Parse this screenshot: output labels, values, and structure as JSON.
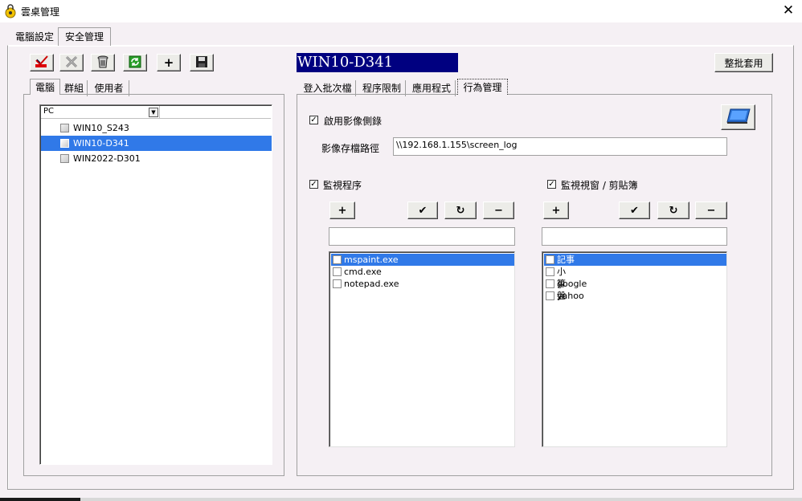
{
  "window": {
    "title": "雲桌管理",
    "close_glyph": "✕",
    "app_icon": "lock-person-icon"
  },
  "top_tabs": [
    {
      "label": "電腦設定",
      "active": false
    },
    {
      "label": "安全管理",
      "active": true
    }
  ],
  "toolbar": [
    {
      "name": "check-icon"
    },
    {
      "name": "cross-icon"
    },
    {
      "name": "trash-icon"
    },
    {
      "name": "refresh-icon"
    },
    {
      "name": "add-icon",
      "glyph": "+"
    },
    {
      "name": "save-icon"
    }
  ],
  "host": {
    "title": "WIN10-D341",
    "batch_apply_label": "整批套用"
  },
  "left_tabs": [
    {
      "label": "電腦",
      "active": true
    },
    {
      "label": "群組",
      "active": false
    },
    {
      "label": "使用者",
      "active": false
    }
  ],
  "tree": {
    "column_header": "PC",
    "dropdown_glyph": "▼",
    "items": [
      {
        "label": "WIN10_S243",
        "selected": false
      },
      {
        "label": "WIN10-D341",
        "selected": true
      },
      {
        "label": "WIN2022-D301",
        "selected": false
      }
    ]
  },
  "right_tabs": [
    {
      "label": "登入批次檔",
      "active": false
    },
    {
      "label": "程序限制",
      "active": false
    },
    {
      "label": "應用程式",
      "active": false
    },
    {
      "label": "行為管理",
      "active": true
    }
  ],
  "behavior": {
    "enable_recording": {
      "label": "啟用影像側錄",
      "checked": true
    },
    "storage_path": {
      "label": "影像存檔路徑",
      "value": "\\\\192.168.1.155\\screen_log"
    },
    "monitor_process": {
      "label": "監視程序",
      "checked": true,
      "input_value": "",
      "items": [
        {
          "label": "mspaint.exe",
          "checked": false,
          "selected": true
        },
        {
          "label": "cmd.exe",
          "checked": false,
          "selected": false
        },
        {
          "label": "notepad.exe",
          "checked": false,
          "selected": false
        }
      ]
    },
    "monitor_window": {
      "label": "監視視窗 / 剪貼簿",
      "checked": true,
      "input_value": "",
      "items": [
        {
          "label": "記事",
          "checked": false,
          "selected": true
        },
        {
          "label": "小算盤",
          "checked": false,
          "selected": false
        },
        {
          "label": "google",
          "checked": false,
          "selected": false
        },
        {
          "label": "yahoo",
          "checked": false,
          "selected": false
        }
      ]
    },
    "list_buttons": {
      "add": "+",
      "confirm": "✔",
      "redo": "↻",
      "remove": "−"
    }
  },
  "colors": {
    "title_bg": "#000080",
    "selection": "#3079e8",
    "window_bg": "#f5f0f4"
  }
}
